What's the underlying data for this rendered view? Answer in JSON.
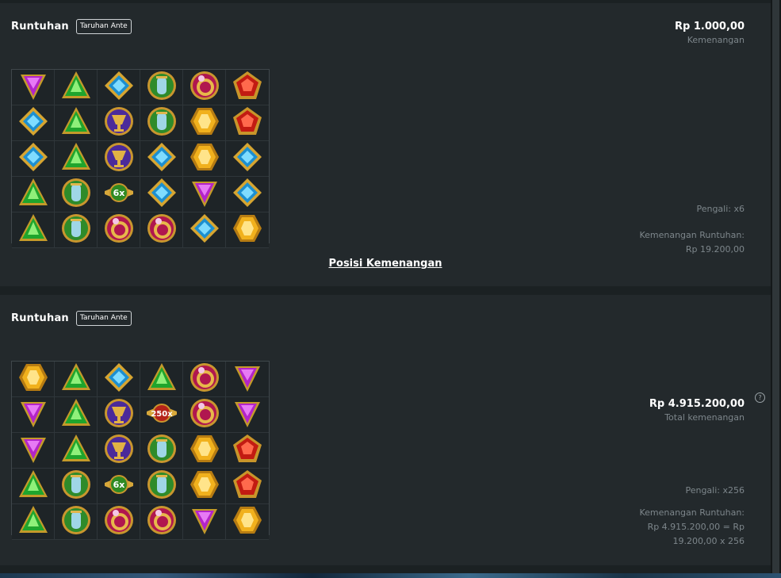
{
  "cascade1": {
    "title": "Runtuhan",
    "badge": "Taruhan Ante",
    "bet_amount": "Rp 1.000,00",
    "bet_label": "Kemenangan",
    "multiplier_text": "Pengali: x6",
    "cascade_win_label": "Kemenangan Runtuhan:",
    "cascade_win_value": "Rp 19.200,00",
    "link_label": "Posisi Kemenangan",
    "grid": [
      [
        "tri-purple",
        "tri-green",
        "dia-blue",
        "urn",
        "ring",
        "pent-red"
      ],
      [
        "dia-blue",
        "tri-green",
        "cup-purple",
        "urn",
        "hex-gold",
        "pent-red"
      ],
      [
        "dia-blue",
        "tri-green",
        "cup-purple",
        "dia-blue",
        "hex-gold",
        "dia-blue"
      ],
      [
        "tri-green",
        "urn",
        "mult",
        "dia-blue",
        "tri-purple",
        "dia-blue"
      ],
      [
        "tri-green",
        "urn",
        "ring",
        "ring",
        "dia-blue",
        "hex-gold"
      ]
    ],
    "mult_labels": {
      "3-2": "6x"
    }
  },
  "cascade2": {
    "title": "Runtuhan",
    "badge": "Taruhan Ante",
    "total_amount": "Rp 4.915.200,00",
    "help_icon": "?",
    "total_label": "Total kemenangan",
    "multiplier_text": "Pengali: x256",
    "cascade_win_label": "Kemenangan Runtuhan:",
    "cascade_win_line1": "Rp 4.915.200,00 = Rp",
    "cascade_win_line2": "19.200,00 x 256",
    "grid": [
      [
        "hex-gold",
        "tri-green",
        "dia-blue",
        "tri-green",
        "ring",
        "tri-purple"
      ],
      [
        "tri-purple",
        "tri-green",
        "cup-purple",
        "mult-red",
        "ring",
        "tri-purple"
      ],
      [
        "tri-purple",
        "tri-green",
        "cup-purple",
        "urn",
        "hex-gold",
        "pent-red"
      ],
      [
        "tri-green",
        "urn",
        "mult",
        "urn",
        "hex-gold",
        "pent-red"
      ],
      [
        "tri-green",
        "urn",
        "ring",
        "ring",
        "tri-purple",
        "hex-gold"
      ]
    ],
    "mult_labels": {
      "1-3": "250x",
      "3-2": "6x"
    }
  },
  "colors": {
    "panel": "#23292c",
    "background": "#1b2123",
    "muted": "#7d868b"
  }
}
